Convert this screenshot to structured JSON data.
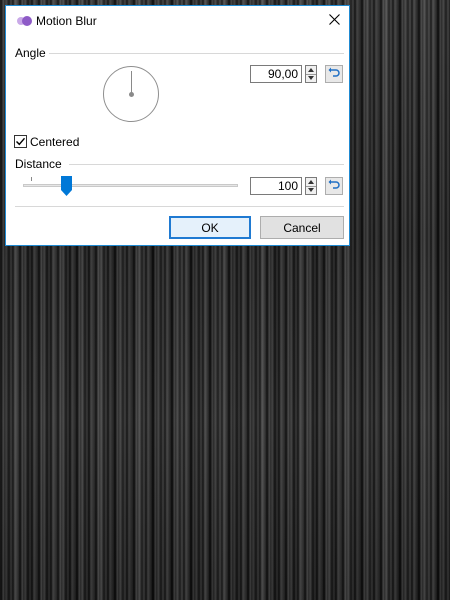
{
  "dialog": {
    "title": "Motion Blur",
    "angle": {
      "label": "Angle",
      "value": "90,00"
    },
    "centered": {
      "label": "Centered",
      "checked": true
    },
    "distance": {
      "label": "Distance",
      "value": "100",
      "slider_fraction": 0.2
    },
    "buttons": {
      "ok": "OK",
      "cancel": "Cancel"
    }
  },
  "icons": {
    "app": "motion-blur-icon",
    "close": "close-icon",
    "spin_up": "chevron-up-icon",
    "spin_down": "chevron-down-icon",
    "reset": "undo-icon",
    "check": "checkmark-icon"
  },
  "colors": {
    "accent": "#0078d7",
    "dialog_border": "#1f8ad2",
    "app_icon": "#8e5bc7"
  }
}
